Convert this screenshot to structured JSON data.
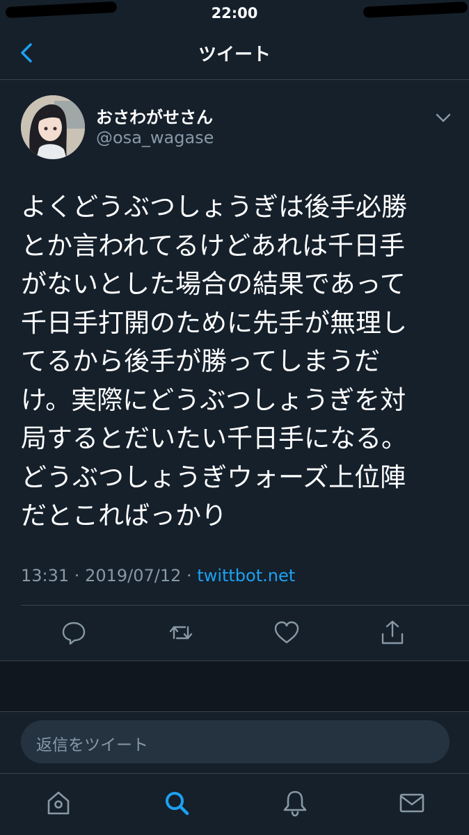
{
  "status_bar": {
    "time": "22:00"
  },
  "nav": {
    "title": "ツイート"
  },
  "tweet": {
    "display_name": "おさわがせさん",
    "handle": "@osa_wagase",
    "text": "よくどうぶつしょうぎは後手必勝\nとか言われてるけどあれは千日手\nがないとした場合の結果であって\n千日手打開のために先手が無理し\nてるから後手が勝ってしまうだ\nけ。実際にどうぶつしょうぎを対\n局するとだいたい千日手になる。\nどうぶつしょうぎウォーズ上位陣\nだとこればっかり",
    "time": "13:31",
    "date": "2019/07/12",
    "source": "twittbot.net",
    "separator": " · "
  },
  "actions": [
    "reply-icon",
    "retweet-icon",
    "like-icon",
    "share-icon"
  ],
  "reply": {
    "placeholder": "返信をツイート"
  },
  "tabs": [
    "home-icon",
    "search-icon",
    "notifications-icon",
    "messages-icon"
  ],
  "colors": {
    "background": "#15202b",
    "secondary_text": "#8899a6",
    "accent": "#1da1f2",
    "divider": "#38444d"
  }
}
